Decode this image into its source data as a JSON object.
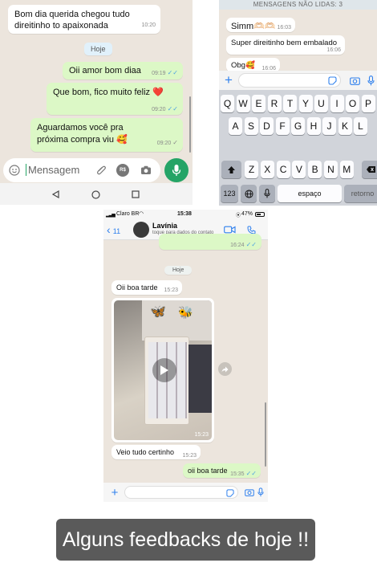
{
  "panel1": {
    "messages": [
      {
        "text": "Bom dia querida chegou tudo direitinho to apaixonada",
        "time": "10:20",
        "side": "in"
      },
      {
        "text": "Oii amor bom diaa",
        "time": "09:19",
        "side": "out"
      },
      {
        "text": "Que bom, fico muito feliz ❤️",
        "time": "09:20",
        "side": "out"
      },
      {
        "text": "Aguardamos você pra próxima compra viu 🥰",
        "time": "09:20",
        "side": "out"
      }
    ],
    "date_label": "Hoje",
    "input_placeholder": "Mensagem",
    "currency_icon_label": "R$"
  },
  "panel2": {
    "unread_banner": "MENSAGENS NÃO LIDAS: 3",
    "messages": [
      {
        "text": "Simm🫶🏻🫶🏻",
        "time": "16:03"
      },
      {
        "text": "Super direitinho bem embalado",
        "time": "16:06"
      },
      {
        "text": "Obg🥰",
        "time": "16:06"
      }
    ],
    "keyboard": {
      "row1": [
        "Q",
        "W",
        "E",
        "R",
        "T",
        "Y",
        "U",
        "I",
        "O",
        "P"
      ],
      "row2": [
        "A",
        "S",
        "D",
        "F",
        "G",
        "H",
        "J",
        "K",
        "L"
      ],
      "row3": [
        "Z",
        "X",
        "C",
        "V",
        "B",
        "N",
        "M"
      ],
      "numbers_key": "123",
      "space_key": "espaço",
      "return_key": "retorno"
    }
  },
  "panel3": {
    "status_bar": {
      "carrier": "Claro BR",
      "time": "15:38",
      "battery": "47%"
    },
    "header": {
      "back_count": "11",
      "contact_name": "Lavínia",
      "subtitle": "toque para dados do contato"
    },
    "partial_message_time": "16:24",
    "date_label": "Hoje",
    "messages": [
      {
        "text": "Oii boa tarde",
        "time": "15:23",
        "side": "in"
      },
      {
        "media_time": "15:23",
        "side": "in",
        "kind": "video"
      },
      {
        "text": "Veio tudo certinho",
        "time": "15:23",
        "side": "in"
      },
      {
        "text": "oii boa tarde",
        "time": "15:35",
        "side": "out"
      }
    ]
  },
  "caption": "Alguns feedbacks de hoje !!",
  "colors": {
    "whatsapp_green": "#25a466",
    "outgoing_bubble": "#dcf8c6",
    "chat_bg": "#ece5dd",
    "read_check": "#4fa3e0"
  }
}
